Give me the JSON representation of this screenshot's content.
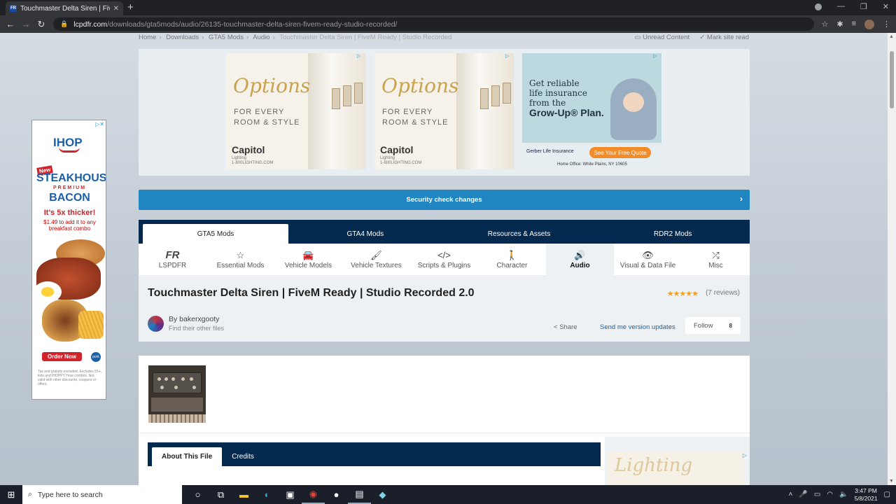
{
  "browser": {
    "tab_title": "Touchmaster Delta Siren | FiveM",
    "url_host": "lcpdfr.com",
    "url_path": "/downloads/gta5mods/audio/26135-touchmaster-delta-siren-fivem-ready-studio-recorded/"
  },
  "breadcrumb": {
    "items": [
      "Home",
      "Downloads",
      "GTA5 Mods",
      "Audio"
    ],
    "current": "Touchmaster Delta Siren | FiveM Ready | Studio Recorded",
    "unread": "Unread Content",
    "mark_read": "Mark site read"
  },
  "ads": {
    "capitol": {
      "headline": "Options",
      "sub1": "FOR EVERY",
      "sub2": "ROOM & STYLE",
      "brand": "Capitol",
      "brand_sub": "Lighting",
      "site": "1-800LIGHTING.COM"
    },
    "gerber": {
      "line1": "Get reliable",
      "line2": "life insurance",
      "line3": "from the",
      "plan": "Grow-Up® Plan.",
      "company": "Gerber Life Insurance",
      "cta": "See Your Free Quote",
      "office": "Home Office: White Plains, NY 10605"
    },
    "ihop": {
      "brand": "IHOP",
      "new": "New",
      "product1": "STEAKHOUSE",
      "premium": "PREMIUM",
      "product2": "BACON",
      "claim": "It's 5x thicker!",
      "price": "$1.49 to add it to any breakfast combo",
      "cta": "Order Now",
      "pork": "pork",
      "fine": "Tax and gratuity excluded. Excludes 55+, kids and IHOPPY Hour combos. Not valid with other discounts, coupons or offers."
    },
    "side": {
      "headline": "Lighting"
    }
  },
  "security": {
    "label": "Security check changes"
  },
  "game_tabs": [
    "GTA5 Mods",
    "GTA4 Mods",
    "Resources & Assets",
    "RDR2 Mods"
  ],
  "categories": [
    {
      "label": "LSPDFR",
      "icon": "FR"
    },
    {
      "label": "Essential Mods",
      "icon": "☆"
    },
    {
      "label": "Vehicle Models",
      "icon": "🚘"
    },
    {
      "label": "Vehicle Textures",
      "icon": "🖌"
    },
    {
      "label": "Scripts & Plugins",
      "icon": "</>"
    },
    {
      "label": "Character",
      "icon": "🚶"
    },
    {
      "label": "Audio",
      "icon": "🔊"
    },
    {
      "label": "Visual & Data File",
      "icon": "👁"
    },
    {
      "label": "Misc",
      "icon": "⤮"
    }
  ],
  "file": {
    "title": "Touchmaster Delta Siren | FiveM Ready | Studio Recorded 2.0",
    "rating": 5,
    "stars": "★★★★★",
    "reviews": "(7 reviews)",
    "author": "By bakerxgooty",
    "find_files": "Find their other files",
    "share": "Share",
    "send_updates": "Send me version updates",
    "follow": "Follow",
    "follow_count": "8"
  },
  "about_tabs": [
    "About This File",
    "Credits"
  ],
  "taskbar": {
    "search_placeholder": "Type here to search",
    "time": "3:47 PM",
    "date": "5/8/2021"
  },
  "colors": {
    "nav_dark": "#032a4e",
    "security_blue": "#1f86c2",
    "star": "#f0a020"
  }
}
